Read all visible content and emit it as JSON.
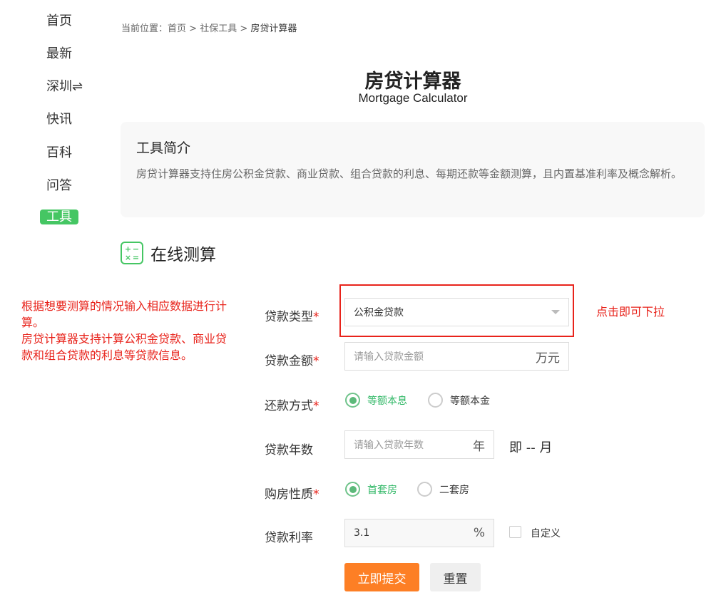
{
  "sidebar": {
    "items": [
      {
        "label": "首页"
      },
      {
        "label": "最新"
      },
      {
        "label": "深圳⇌"
      },
      {
        "label": "快讯"
      },
      {
        "label": "百科"
      },
      {
        "label": "问答"
      },
      {
        "label": "工具",
        "active": true
      }
    ]
  },
  "breadcrumb": {
    "prefix": "当前位置：",
    "items": [
      "首页",
      "社保工具",
      "房贷计算器"
    ],
    "sep": " > "
  },
  "header": {
    "title": "房贷计算器",
    "subtitle": "Mortgage Calculator"
  },
  "intro": {
    "title": "工具简介",
    "text": "房贷计算器支持住房公积金贷款、商业贷款、组合贷款的利息、每期还款等金额测算，且内置基准利率及概念解析。"
  },
  "section": {
    "title": "在线测算",
    "icon": "calculator-icon"
  },
  "annotations": {
    "left": "根据想要测算的情况输入相应数据进行计算。\n房贷计算器支持计算公积金贷款、商业贷款和组合贷款的利息等贷款信息。",
    "right": "点击即可下拉"
  },
  "form": {
    "loan_type": {
      "label": "贷款类型",
      "value": "公积金贷款"
    },
    "amount": {
      "label": "贷款金额",
      "placeholder": "请输入贷款金额",
      "unit": "万元"
    },
    "repay": {
      "label": "还款方式",
      "options": [
        "等额本息",
        "等额本金"
      ],
      "selected": "等额本息"
    },
    "years": {
      "label": "贷款年数",
      "placeholder": "请输入贷款年数",
      "unit": "年",
      "months_text": "即 -- 月"
    },
    "nature": {
      "label": "购房性质",
      "options": [
        "首套房",
        "二套房"
      ],
      "selected": "首套房"
    },
    "rate": {
      "label": "贷款利率",
      "value": "3.1",
      "unit": "%",
      "custom_label": "自定义",
      "custom_checked": false
    },
    "required_mark": "*",
    "submit": "立即提交",
    "reset": "重置"
  },
  "colors": {
    "accent": "#45c663",
    "submit": "#fd7f25",
    "required": "#e8231b"
  }
}
